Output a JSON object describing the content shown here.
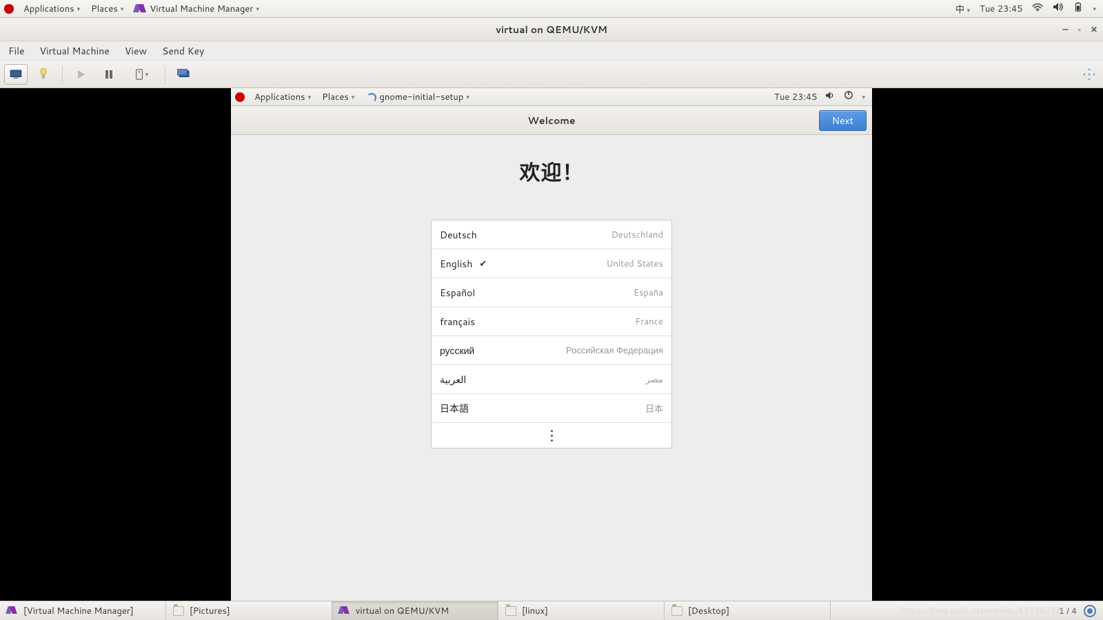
{
  "host_panel": {
    "applications": "Applications",
    "places": "Places",
    "active_app": "Virtual Machine Manager",
    "ime": "中",
    "clock": "Tue 23:45"
  },
  "vmm": {
    "title": "virtual on QEMU/KVM",
    "menu": {
      "file": "File",
      "vm": "Virtual Machine",
      "view": "View",
      "sendkey": "Send Key"
    }
  },
  "guest_panel": {
    "applications": "Applications",
    "places": "Places",
    "active_app": "gnome-initial-setup",
    "clock": "Tue 23:45"
  },
  "gis": {
    "header_title": "Welcome",
    "next": "Next",
    "heading": "欢迎！",
    "languages": [
      {
        "name": "Deutsch",
        "region": "Deutschland",
        "selected": false
      },
      {
        "name": "English",
        "region": "United States",
        "selected": true
      },
      {
        "name": "Español",
        "region": "España",
        "selected": false
      },
      {
        "name": "français",
        "region": "France",
        "selected": false
      },
      {
        "name": "русский",
        "region": "Российская Федерация",
        "selected": false
      },
      {
        "name": "العربية",
        "region": "مصر",
        "selected": false
      },
      {
        "name": "日本語",
        "region": "日本",
        "selected": false
      }
    ]
  },
  "taskbar": {
    "items": [
      {
        "label": "[Virtual Machine Manager]",
        "icon": "vmm",
        "active": false
      },
      {
        "label": "[Pictures]",
        "icon": "folder",
        "active": false
      },
      {
        "label": "virtual on QEMU/KVM",
        "icon": "vmm",
        "active": true
      },
      {
        "label": "[linux]",
        "icon": "folder",
        "active": false
      },
      {
        "label": "[Desktop]",
        "icon": "folder",
        "active": false
      }
    ],
    "page_indicator": "1 / 4"
  },
  "watermark": "https://blog.csdn.net/weixin_43996356"
}
